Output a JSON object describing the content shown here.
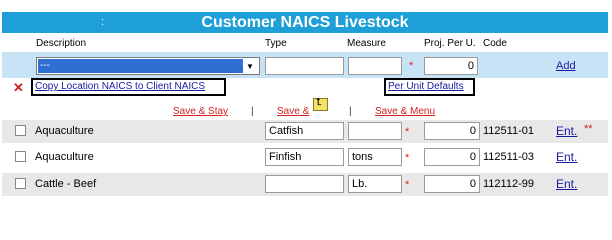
{
  "title": "Customer NAICS Livestock",
  "title_colon": ":",
  "columns": {
    "description": "Description",
    "type": "Type",
    "measure": "Measure",
    "proj_per_u": "Proj. Per U.",
    "code": "Code"
  },
  "new_row": {
    "description_selected": "---",
    "type_value": "",
    "measure_value": "",
    "required_mark": "*",
    "proj_value": "0",
    "add_label": "Add"
  },
  "links": {
    "copy_location": "Copy Location NAICS to Client NAICS",
    "per_unit_defaults": "Per Unit Defaults"
  },
  "actions": {
    "save_stay": "Save & Stay",
    "save_and": "Save &",
    "save_menu": "Save & Menu",
    "separator": "|"
  },
  "rows": [
    {
      "description": "Aquaculture",
      "type": "Catfish",
      "measure": "",
      "required": "*",
      "proj": "0",
      "code": "112511-01",
      "ent": "Ent.",
      "stars": "**"
    },
    {
      "description": "Aquaculture",
      "type": "Finfish",
      "measure": "tons",
      "required": "*",
      "proj": "0",
      "code": "112511-03",
      "ent": "Ent.",
      "stars": ""
    },
    {
      "description": "Cattle - Beef",
      "type": "",
      "measure": "Lb.",
      "required": "*",
      "proj": "0",
      "code": "112112-99",
      "ent": "Ent.",
      "stars": ""
    }
  ],
  "colors": {
    "header_blue": "#1e9fd8",
    "panel_blue": "#c9e3f6",
    "required_red": "#e02020",
    "link_blue": "#1a1aa0"
  }
}
